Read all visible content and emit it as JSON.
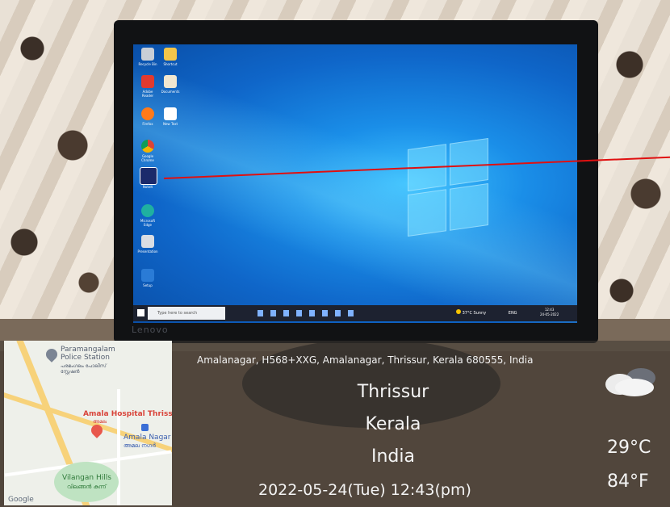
{
  "monitor": {
    "brand": "Lenovo",
    "taskbar": {
      "search_placeholder": "Type here to search",
      "tray_weather": "37°C Sunny",
      "tray_lang": "ENG",
      "clock_time": "12:43",
      "clock_date": "24-05-2022"
    },
    "desktop_icons": [
      "Recycle Bin",
      "Shortcut",
      "Adobe Reader",
      "Documents",
      "Firefox",
      "New Text",
      "Google Chrome",
      "NoteIt",
      "Microsoft Edge",
      "Presentation",
      "Setup"
    ]
  },
  "map": {
    "watermark": "Google",
    "labels": {
      "police_station": "Paramangalam Police Station",
      "police_station_ml": "പരമംഗലം പോലീസ് സ്റ്റേഷൻ",
      "hospital": "Amala Hospital Thrissur",
      "hospital_ml": "അമല",
      "bus_stop": "Amala Nagar",
      "bus_stop_ml": "അമല നഗർ",
      "hills": "Vilangan Hills",
      "hills_ml": "വിലങ്ങൻ കുന്ന്"
    }
  },
  "location": {
    "address": "Amalanagar, H568+XXG, Amalanagar, Thrissur, Kerala 680555, India",
    "city": "Thrissur",
    "state": "Kerala",
    "country": "India"
  },
  "timestamp": "2022-05-24(Tue)   12:43(pm)",
  "weather": {
    "icon": "cloud-icon",
    "temp_c": "29°C",
    "temp_f": "84°F"
  }
}
